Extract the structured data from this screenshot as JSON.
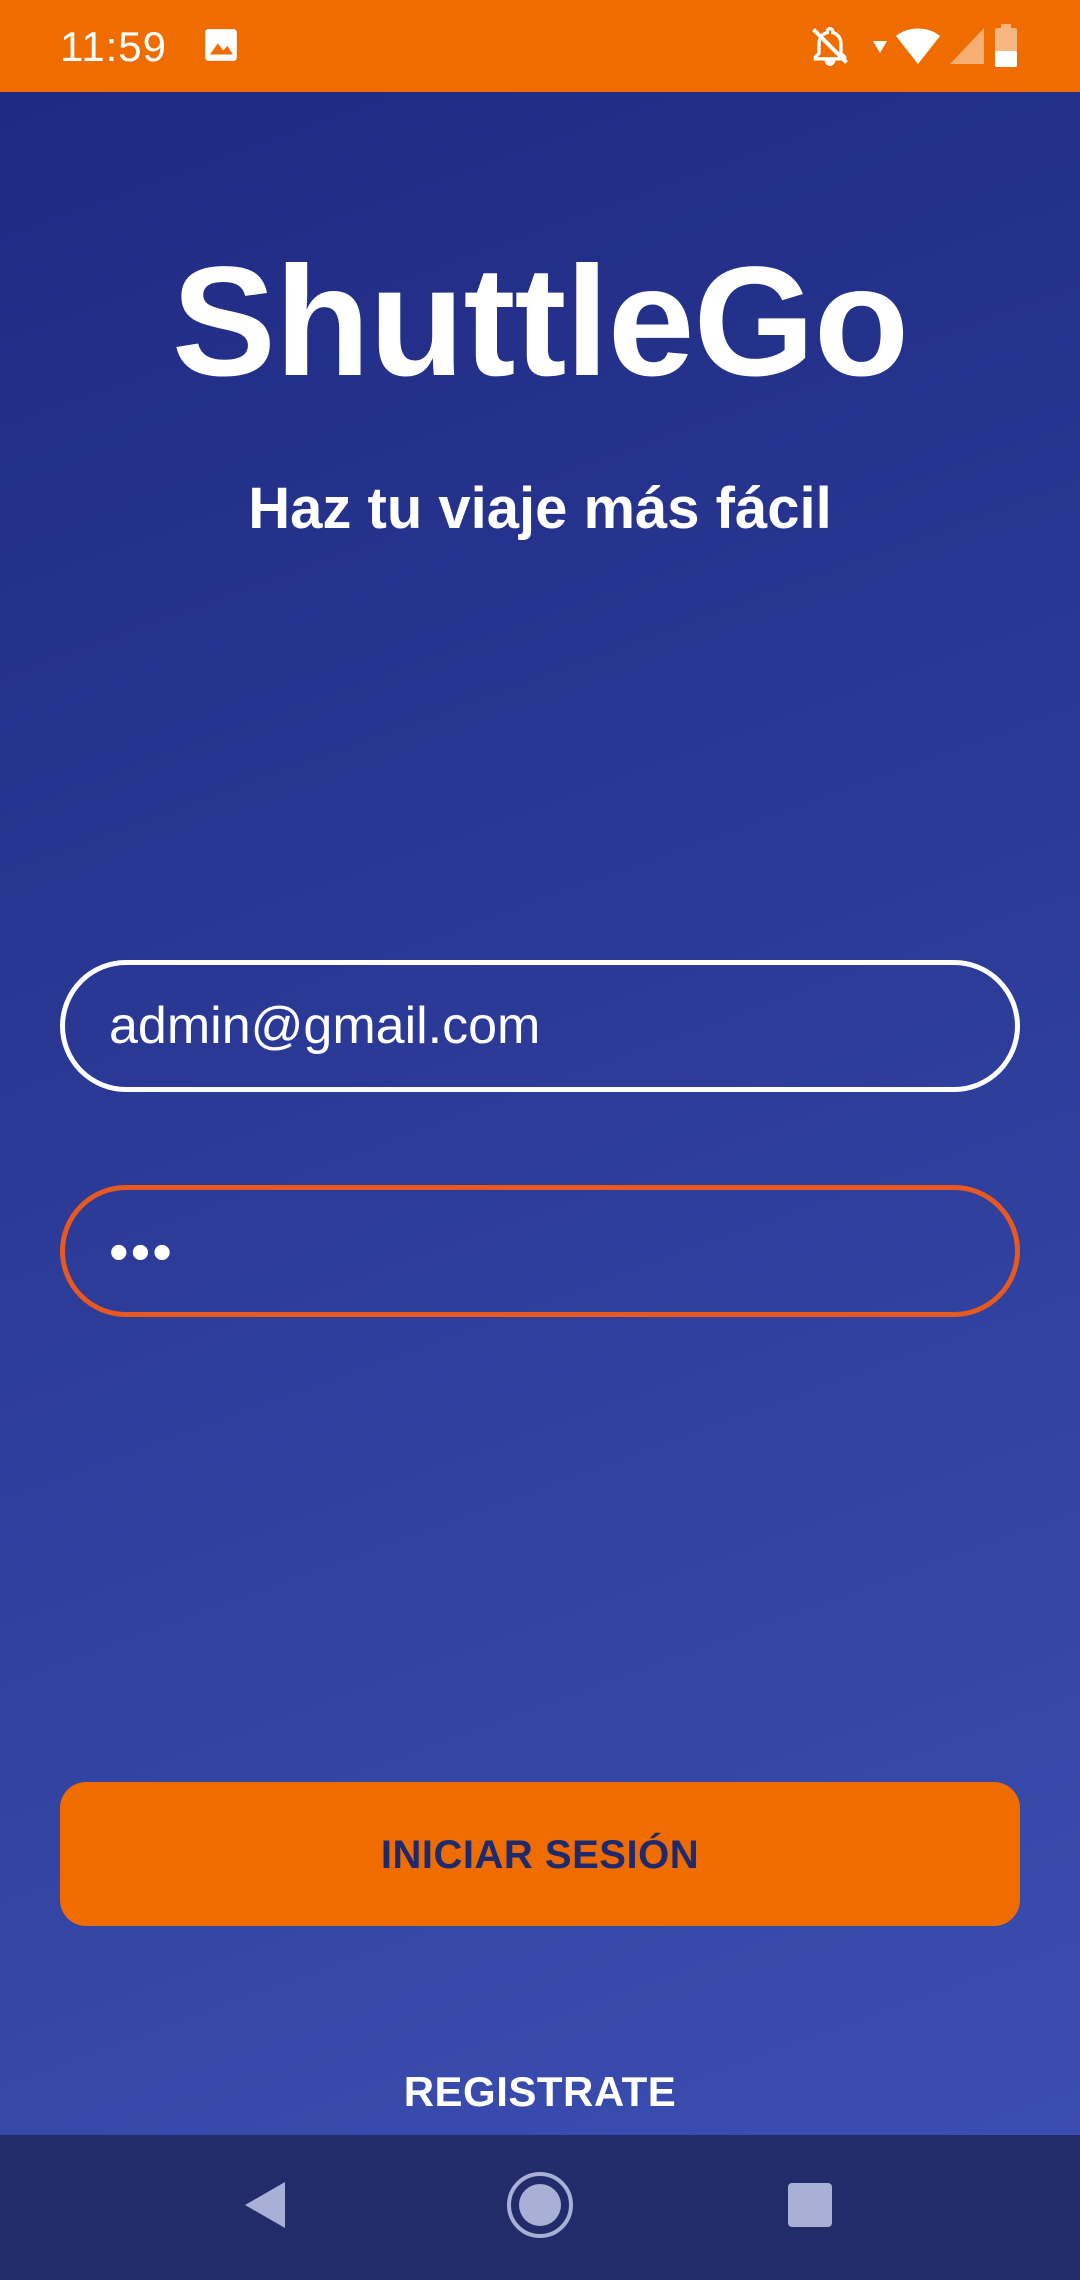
{
  "status_bar": {
    "time": "11:59",
    "icons": [
      "image-icon",
      "notifications-off-icon",
      "wifi-icon",
      "cell-signal-icon",
      "battery-icon"
    ],
    "background_color": "#ef6c00"
  },
  "app": {
    "title": "ShuttleGo",
    "subtitle": "Haz tu viaje más fácil"
  },
  "login_form": {
    "email_value": "admin@gmail.com",
    "password_value": "•••",
    "login_button_label": "INICIAR SESIÓN",
    "register_link_label": "REGISTRATE"
  },
  "colors": {
    "accent": "#ef6c00",
    "background_top": "#1f2a82",
    "background_bottom": "#3b4eb0",
    "focused_field_border": "#e8591f",
    "nav_bar": "#232c6b"
  },
  "nav_bar": {
    "icons": [
      "back-icon",
      "home-icon",
      "recents-icon"
    ]
  }
}
